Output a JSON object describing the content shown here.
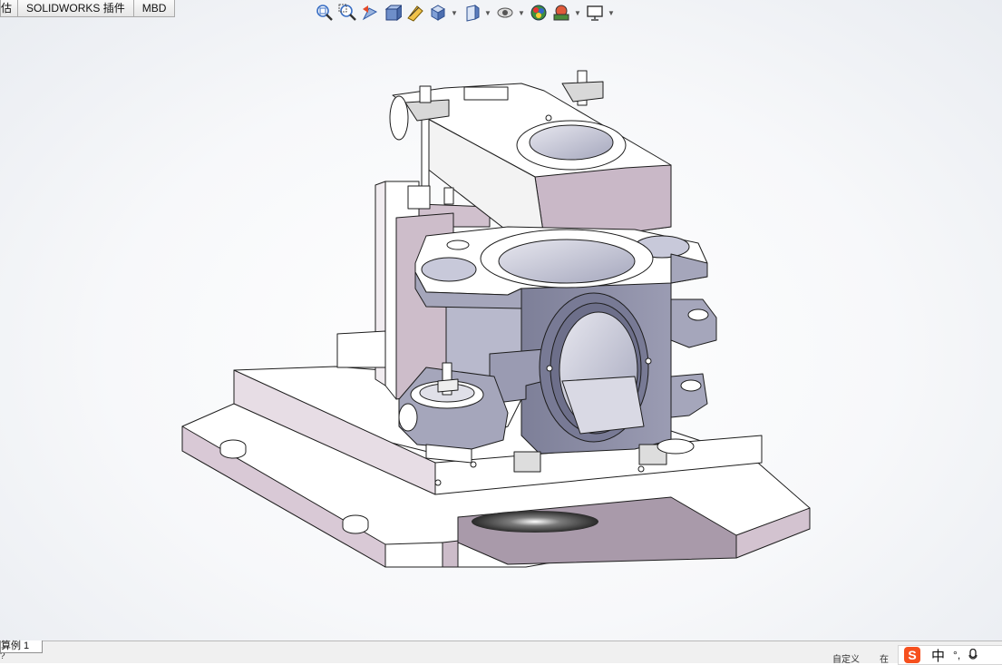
{
  "command_tabs": [
    {
      "label": "估"
    },
    {
      "label": "SOLIDWORKS 插件"
    },
    {
      "label": "MBD"
    }
  ],
  "view_toolbar": [
    {
      "icon": "zoom-to-fit-icon"
    },
    {
      "icon": "zoom-to-area-icon"
    },
    {
      "icon": "previous-view-icon"
    },
    {
      "icon": "section-view-icon"
    },
    {
      "icon": "dynamic-annotation-icon"
    },
    {
      "icon": "view-orientation-icon",
      "dropdown": true
    },
    {
      "icon": "display-style-icon",
      "dropdown": true
    },
    {
      "icon": "hide-show-items-icon",
      "dropdown": true
    },
    {
      "icon": "edit-appearance-icon"
    },
    {
      "icon": "apply-scene-icon",
      "dropdown": true
    },
    {
      "icon": "view-settings-icon",
      "dropdown": true
    }
  ],
  "sheet_tab": {
    "label": "算例 1"
  },
  "status": {
    "left": "?",
    "custom": "自定义",
    "partial": "在"
  },
  "ime": {
    "char": "中",
    "punct": "°,",
    "mic": "mic-icon",
    "logo": "S"
  },
  "colors": {
    "part_face": "#ffffff",
    "part_shadow": "#c8b8c6",
    "part_dark": "#8f90a8",
    "edge": "#222222"
  }
}
